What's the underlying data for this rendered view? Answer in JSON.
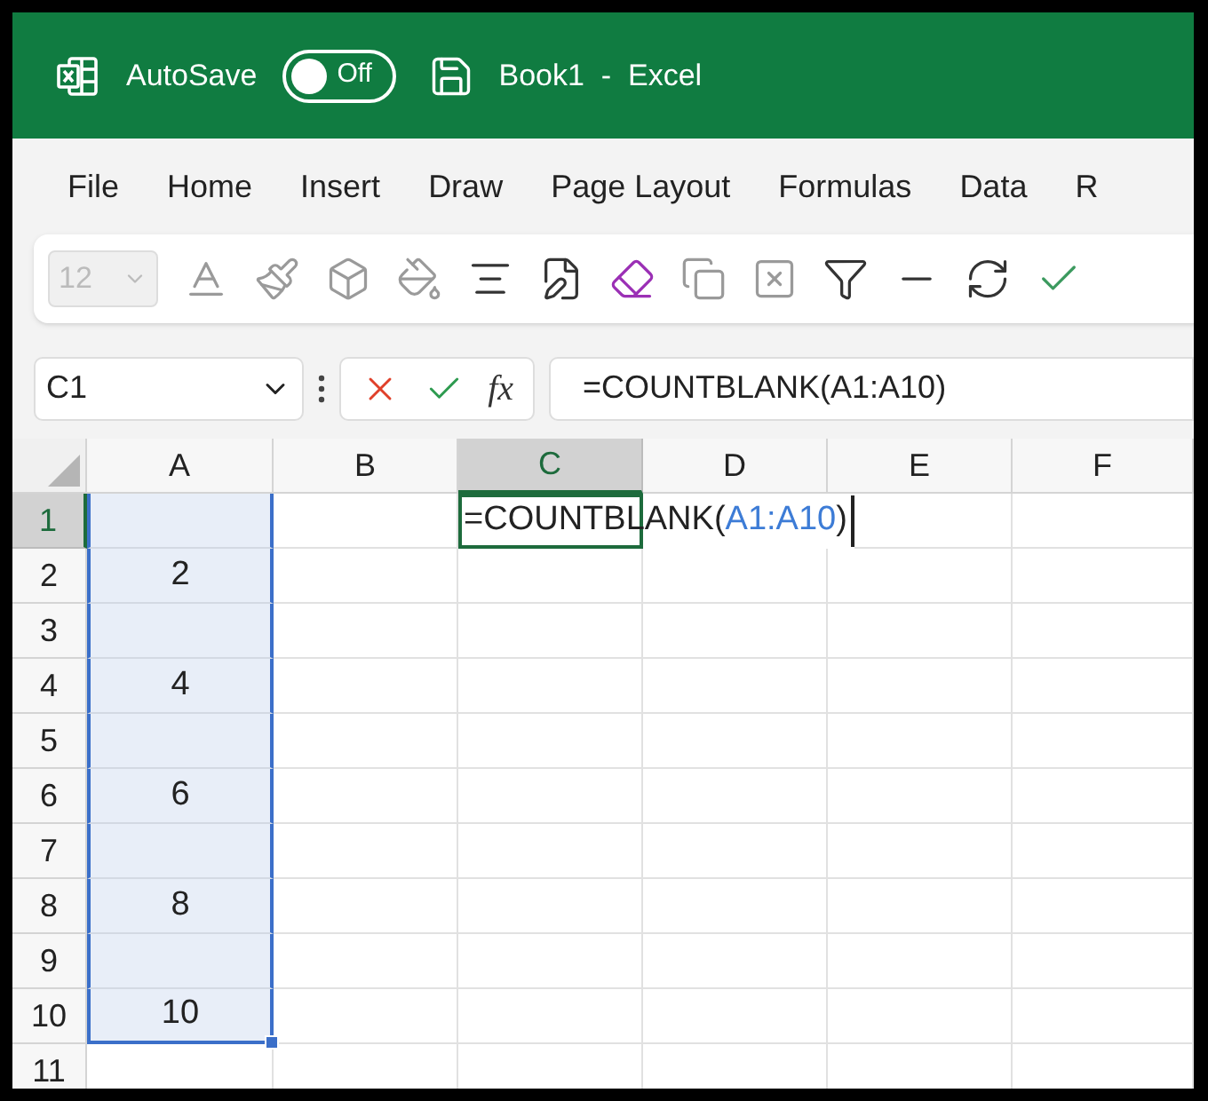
{
  "title_bar": {
    "autosave_label": "AutoSave",
    "autosave": {
      "on": false,
      "label": "Off"
    },
    "title": "Book1  -  Excel"
  },
  "menu": [
    "File",
    "Home",
    "Insert",
    "Draw",
    "Page Layout",
    "Formulas",
    "Data",
    "R"
  ],
  "toolbar": {
    "font_size": {
      "value": "12",
      "disabled": true
    },
    "buttons": [
      {
        "kind": "font-color",
        "disabled": true
      },
      {
        "kind": "brush",
        "disabled": true
      },
      {
        "kind": "box",
        "disabled": true
      },
      {
        "kind": "fill",
        "disabled": true
      },
      {
        "kind": "align",
        "disabled": false
      },
      {
        "kind": "save-edit",
        "disabled": false
      },
      {
        "kind": "eraser",
        "disabled": false
      },
      {
        "kind": "copy",
        "disabled": true
      },
      {
        "kind": "clear",
        "disabled": true
      },
      {
        "kind": "filter",
        "disabled": false
      },
      {
        "kind": "line",
        "disabled": false
      },
      {
        "kind": "refresh",
        "disabled": false
      },
      {
        "kind": "check",
        "disabled": false
      }
    ]
  },
  "formula_bar": {
    "name_box": "C1",
    "function_label": "fx",
    "formula": "=COUNTBLANK(A1:A10)"
  },
  "grid": {
    "columns": [
      {
        "label": "A",
        "selected": false,
        "in_range": true
      },
      {
        "label": "B",
        "selected": false,
        "in_range": false
      },
      {
        "label": "C",
        "selected": true,
        "in_range": false
      },
      {
        "label": "D",
        "selected": false,
        "in_range": false
      },
      {
        "label": "E",
        "selected": false,
        "in_range": false
      },
      {
        "label": "F",
        "selected": false,
        "in_range": false
      }
    ],
    "rows": [
      {
        "label": "1",
        "selected": true,
        "in_range": true,
        "cells": [
          {
            "kind": "empty"
          },
          {
            "kind": "empty"
          },
          {
            "kind": "formula",
            "parts": [
              {
                "text": "=COUNTBLANK(",
                "kind": "plain"
              },
              {
                "text": "A1:A10",
                "kind": "reference"
              },
              {
                "text": ")",
                "kind": "plain"
              }
            ]
          }
        ]
      },
      {
        "label": "2",
        "selected": false,
        "in_range": true,
        "cells": [
          {
            "kind": "value",
            "text": "2"
          }
        ]
      },
      {
        "label": "3",
        "selected": false,
        "in_range": true,
        "cells": []
      },
      {
        "label": "4",
        "selected": false,
        "in_range": true,
        "cells": [
          {
            "kind": "value",
            "text": "4"
          }
        ]
      },
      {
        "label": "5",
        "selected": false,
        "in_range": true,
        "cells": []
      },
      {
        "label": "6",
        "selected": false,
        "in_range": true,
        "cells": [
          {
            "kind": "value",
            "text": "6"
          }
        ]
      },
      {
        "label": "7",
        "selected": false,
        "in_range": true,
        "cells": []
      },
      {
        "label": "8",
        "selected": false,
        "in_range": true,
        "cells": [
          {
            "kind": "value",
            "text": "8"
          }
        ]
      },
      {
        "label": "9",
        "selected": false,
        "in_range": true,
        "cells": []
      },
      {
        "label": "10",
        "selected": false,
        "in_range": true,
        "cells": [
          {
            "kind": "value",
            "text": "10"
          }
        ]
      },
      {
        "label": "11",
        "selected": false,
        "in_range": false,
        "cells": []
      }
    ]
  }
}
